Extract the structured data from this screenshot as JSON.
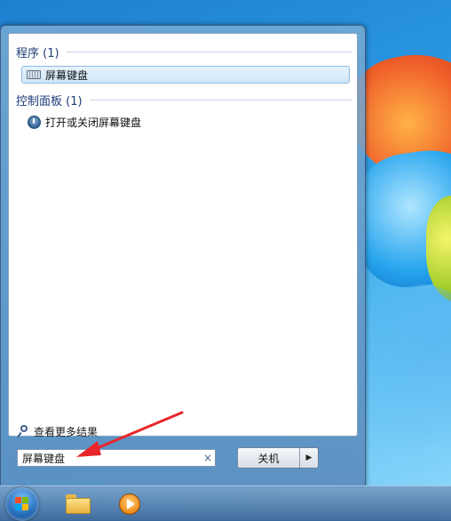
{
  "search_results": {
    "groups": [
      {
        "header": "程序 (1)",
        "items": [
          {
            "label": "屏幕键盘",
            "icon": "keyboard-icon",
            "selected": true
          }
        ]
      },
      {
        "header": "控制面板 (1)",
        "items": [
          {
            "label": "打开或关闭屏幕键盘",
            "icon": "ease-of-access-icon",
            "selected": false
          }
        ]
      }
    ],
    "see_more": "查看更多结果"
  },
  "search_box": {
    "value": "屏幕键盘",
    "clear_glyph": "×"
  },
  "shutdown": {
    "label": "关机",
    "arrow_glyph": "▶"
  },
  "taskbar": {
    "items": [
      "start-orb",
      "windows-explorer-icon",
      "media-player-icon"
    ]
  },
  "colors": {
    "annotation_arrow": "#e8262a",
    "selection_bg": "#cfe6f8",
    "header_text": "#1e3c78"
  }
}
